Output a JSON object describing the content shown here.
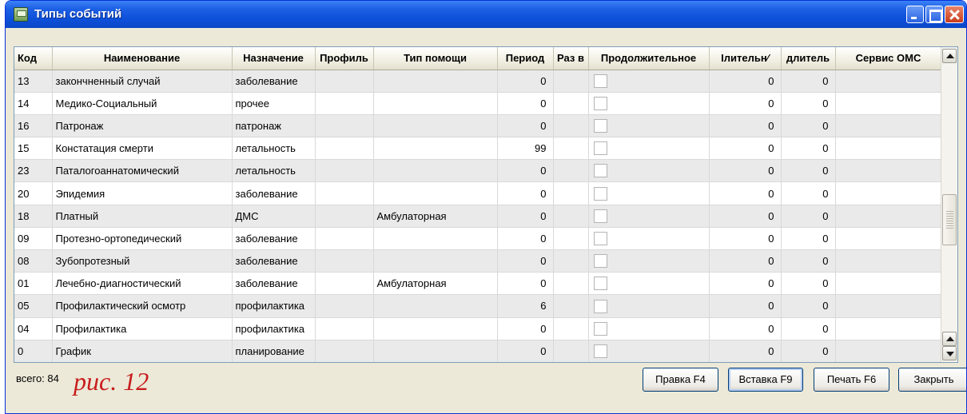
{
  "window": {
    "title": "Типы событий"
  },
  "grid": {
    "columns": [
      "Код",
      "Наименование",
      "Назначение",
      "Профиль",
      "Тип помощи",
      "Период",
      "Раз в",
      "Продолжительное",
      "Ілительн∕",
      "длитель",
      "Сервис ОМС"
    ],
    "rows": [
      {
        "code": "13",
        "name": "закончненный случай",
        "purpose": "заболевание",
        "profile": "",
        "aid": "",
        "period": "0",
        "times": "",
        "long": false,
        "d1": "0",
        "d2": "0",
        "oms": ""
      },
      {
        "code": "14",
        "name": "Медико-Социальный",
        "purpose": "прочее",
        "profile": "",
        "aid": "",
        "period": "0",
        "times": "",
        "long": false,
        "d1": "0",
        "d2": "0",
        "oms": ""
      },
      {
        "code": "16",
        "name": "Патронаж",
        "purpose": "патронаж",
        "profile": "",
        "aid": "",
        "period": "0",
        "times": "",
        "long": false,
        "d1": "0",
        "d2": "0",
        "oms": ""
      },
      {
        "code": "15",
        "name": "Констатация смерти",
        "purpose": "летальность",
        "profile": "",
        "aid": "",
        "period": "99",
        "times": "",
        "long": false,
        "d1": "0",
        "d2": "0",
        "oms": ""
      },
      {
        "code": "23",
        "name": "Паталогоаннатомический",
        "purpose": "летальность",
        "profile": "",
        "aid": "",
        "period": "0",
        "times": "",
        "long": false,
        "d1": "0",
        "d2": "0",
        "oms": ""
      },
      {
        "code": "20",
        "name": "Эпидемия",
        "purpose": "заболевание",
        "profile": "",
        "aid": "",
        "period": "0",
        "times": "",
        "long": false,
        "d1": "0",
        "d2": "0",
        "oms": ""
      },
      {
        "code": "18",
        "name": "Платный",
        "purpose": "ДМС",
        "profile": "",
        "aid": "Амбулаторная",
        "period": "0",
        "times": "",
        "long": false,
        "d1": "0",
        "d2": "0",
        "oms": ""
      },
      {
        "code": "09",
        "name": "Протезно-ортопедический",
        "purpose": "заболевание",
        "profile": "",
        "aid": "",
        "period": "0",
        "times": "",
        "long": false,
        "d1": "0",
        "d2": "0",
        "oms": ""
      },
      {
        "code": "08",
        "name": "Зубопротезный",
        "purpose": "заболевание",
        "profile": "",
        "aid": "",
        "period": "0",
        "times": "",
        "long": false,
        "d1": "0",
        "d2": "0",
        "oms": ""
      },
      {
        "code": "01",
        "name": "Лечебно-диагностический",
        "purpose": "заболевание",
        "profile": "",
        "aid": "Амбулаторная",
        "period": "0",
        "times": "",
        "long": false,
        "d1": "0",
        "d2": "0",
        "oms": ""
      },
      {
        "code": "05",
        "name": "Профилактический осмотр",
        "purpose": "профилактика",
        "profile": "",
        "aid": "",
        "period": "6",
        "times": "",
        "long": false,
        "d1": "0",
        "d2": "0",
        "oms": ""
      },
      {
        "code": "04",
        "name": "Профилактика",
        "purpose": "профилактика",
        "profile": "",
        "aid": "",
        "period": "0",
        "times": "",
        "long": false,
        "d1": "0",
        "d2": "0",
        "oms": ""
      },
      {
        "code": "0",
        "name": "График",
        "purpose": "планирование",
        "profile": "",
        "aid": "",
        "period": "0",
        "times": "",
        "long": false,
        "d1": "0",
        "d2": "0",
        "oms": ""
      }
    ]
  },
  "footer": {
    "total": "всего: 84",
    "figure_label": "рис. 12",
    "buttons": {
      "edit": "Правка F4",
      "insert": "Вставка F9",
      "print": "Печать F6",
      "close": "Закрыть"
    }
  }
}
